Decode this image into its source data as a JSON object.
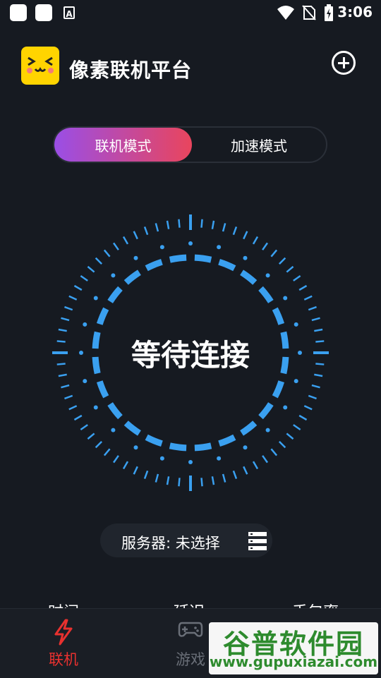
{
  "status_bar": {
    "time": "3:06",
    "notif_badge": "A"
  },
  "header": {
    "title": "像素联机平台",
    "logo_icon": "pixel-face-logo",
    "add_icon": "plus-circle-icon"
  },
  "mode_switch": {
    "active_label": "联机模式",
    "inactive_label": "加速模式"
  },
  "dial": {
    "status_text": "等待连接",
    "accent_color": "#3aa0f0"
  },
  "server": {
    "label": "服务器:  未选择",
    "icon": "server-list-icon"
  },
  "stats": {
    "labels": [
      "时间",
      "延迟",
      "丢包率"
    ]
  },
  "tabs": [
    {
      "label": "联机",
      "icon": "lightning-icon",
      "active": true
    },
    {
      "label": "游戏",
      "icon": "gamepad-icon",
      "active": false
    }
  ],
  "watermark": {
    "title": "谷普软件园",
    "url": "www.gupuxiazai.com"
  }
}
